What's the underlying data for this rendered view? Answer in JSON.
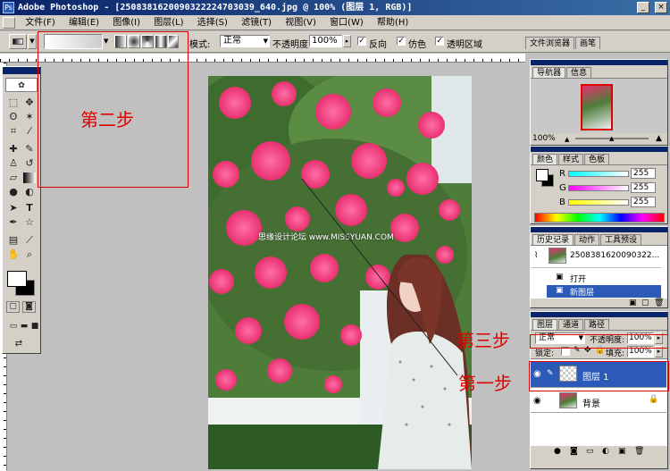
{
  "window": {
    "title": "Adobe Photoshop - [2508381620090322224703039_640.jpg @ 100% (图层 1, RGB)]",
    "controls": {
      "minimize": "_",
      "maximize": "□",
      "close": "×"
    }
  },
  "menu": [
    "文件(F)",
    "编辑(E)",
    "图像(I)",
    "图层(L)",
    "选择(S)",
    "滤镜(T)",
    "视图(V)",
    "窗口(W)",
    "帮助(H)"
  ],
  "options": {
    "mode_label": "模式:",
    "mode_value": "正常",
    "opacity_label": "不透明度:",
    "opacity_value": "100%",
    "reverse": "反向",
    "dither": "仿色",
    "transparency": "透明区域",
    "browser_tab": "文件浏览器",
    "brush_tab": "画笔"
  },
  "canvas": {
    "watermark": "思缘设计论坛 www.MISSYUAN.COM"
  },
  "annotations": {
    "step1": "第一步",
    "step2": "第二步",
    "step3": "第三步"
  },
  "navigator": {
    "tabs": [
      "导航器",
      "信息"
    ],
    "zoom": "100%"
  },
  "color": {
    "tabs": [
      "颜色",
      "样式",
      "色板"
    ],
    "channels": [
      {
        "label": "R",
        "value": "255"
      },
      {
        "label": "G",
        "value": "255"
      },
      {
        "label": "B",
        "value": "255"
      }
    ]
  },
  "history": {
    "tabs": [
      "历史记录",
      "动作",
      "工具预设"
    ],
    "snapshot": "2508381620090322...",
    "items": [
      "打开",
      "新图层"
    ]
  },
  "layers": {
    "tabs": [
      "图层",
      "通道",
      "路径"
    ],
    "blend_mode": "正常",
    "opacity_label": "不透明度:",
    "opacity_value": "100%",
    "lock_label": "锁定:",
    "fill_label": "填充:",
    "fill_value": "100%",
    "rows": [
      {
        "name": "图层 1",
        "selected": true
      },
      {
        "name": "背景",
        "selected": false
      }
    ]
  },
  "colors": {
    "title_bar": "#0a246a",
    "selection": "#2c5ab8",
    "annotation": "#e00000"
  }
}
